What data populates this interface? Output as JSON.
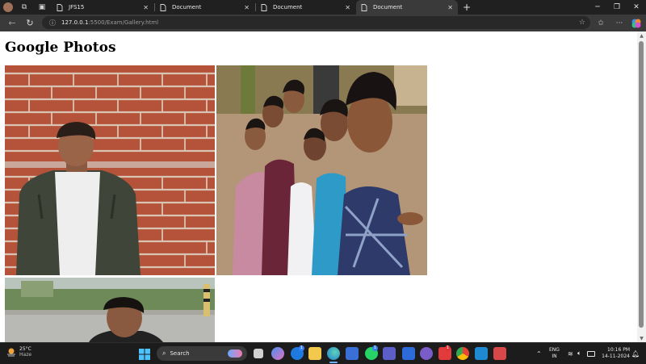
{
  "browser": {
    "tabs": [
      {
        "label": "JFS15",
        "icon": "page-icon",
        "active": false
      },
      {
        "label": "Document",
        "icon": "page-icon",
        "active": false
      },
      {
        "label": "Document",
        "icon": "page-icon",
        "active": false
      },
      {
        "label": "Document",
        "icon": "page-icon",
        "active": true
      }
    ],
    "address": {
      "host": "127.0.0.1",
      "path": ":5500/Exam/Gallery.html"
    }
  },
  "page": {
    "title": "Google Photos",
    "photos": [
      {
        "subject": "man-by-brick-wall"
      },
      {
        "subject": "group-selfie"
      },
      {
        "subject": "man-outdoors"
      }
    ]
  },
  "taskbar": {
    "weather": {
      "temp": "25°C",
      "condition": "Haze"
    },
    "search_placeholder": "Search",
    "language": {
      "line1": "ENG",
      "line2": "IN"
    },
    "clock": {
      "time": "10:16 PM",
      "date": "14-11-2024"
    },
    "badges": {
      "edge_notifications": "1",
      "whatsapp_notifications": "1",
      "app_notifications": "1"
    }
  }
}
